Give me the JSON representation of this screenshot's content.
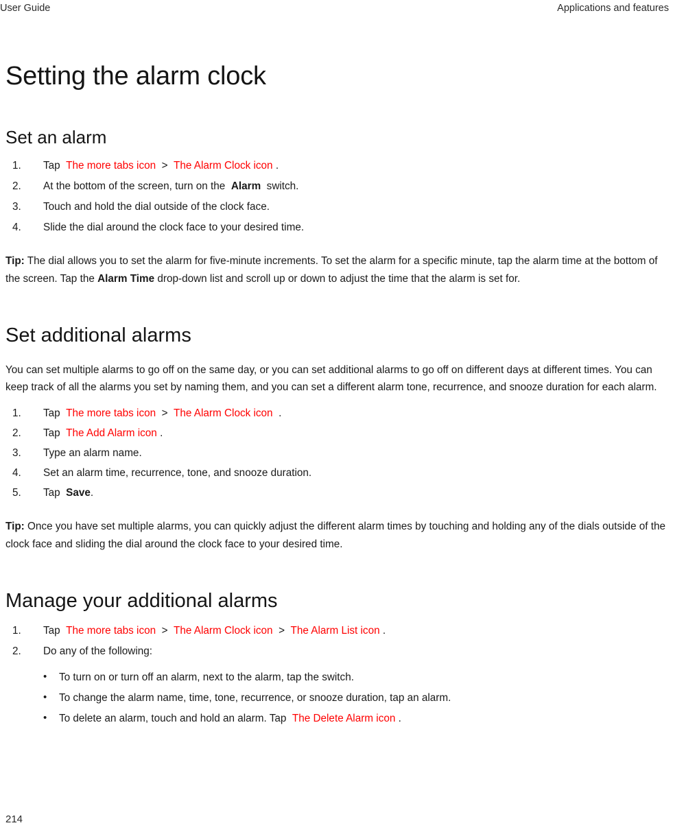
{
  "header": {
    "left": "User Guide",
    "right": "Applications and features"
  },
  "title": "Setting the alarm clock",
  "colors": {
    "icon_reference": "#ff0000",
    "text": "#1a1a1a",
    "background": "#ffffff"
  },
  "sections": {
    "set_an_alarm": {
      "heading": "Set an alarm",
      "steps": [
        {
          "pre": "Tap",
          "icon1": "The more tabs icon",
          "sep": ">",
          "icon2": "The Alarm Clock icon",
          "post": "."
        },
        {
          "pre": "At the bottom of the screen, turn on the",
          "bold": "Alarm",
          "post": "switch."
        },
        {
          "pre": "Touch and hold the dial outside of the clock face."
        },
        {
          "pre": "Slide the dial around the clock face to your desired time."
        }
      ],
      "tip": {
        "label": "Tip:",
        "part1": "The dial allows you to set the alarm for five-minute increments. To set the alarm for a specific minute, tap the alarm time at the bottom of the screen. Tap the",
        "bold": "Alarm Time",
        "part2": "drop-down list and scroll up or down to adjust the time that the alarm is set for."
      }
    },
    "set_additional_alarms": {
      "heading": "Set additional alarms",
      "intro": "You can set multiple alarms to go off on the same day, or you can set additional alarms to go off on different days at different times. You can keep track of all the alarms you set by naming them, and you can set a different alarm tone, recurrence, and snooze duration for each alarm.",
      "steps": [
        {
          "pre": "Tap",
          "icon1": "The more tabs icon",
          "sep": ">",
          "icon2": "The Alarm Clock icon",
          "post": "."
        },
        {
          "pre": "Tap",
          "icon1": "The Add Alarm icon",
          "post": "."
        },
        {
          "pre": "Type an alarm name."
        },
        {
          "pre": "Set an alarm time, recurrence, tone, and snooze duration."
        },
        {
          "pre": "Tap",
          "bold": "Save",
          "post": "."
        }
      ],
      "tip": {
        "label": "Tip:",
        "part1": "Once you have set multiple alarms, you can quickly adjust the different alarm times by touching and holding any of the dials outside of the clock face and sliding the dial around the clock face to your desired time."
      }
    },
    "manage_additional_alarms": {
      "heading": "Manage your additional alarms",
      "steps": [
        {
          "pre": "Tap",
          "icon1": "The more tabs icon",
          "sep1": ">",
          "icon2": "The Alarm Clock icon",
          "sep2": ">",
          "icon3": "The Alarm List icon",
          "post": "."
        },
        {
          "pre": "Do any of the following:"
        }
      ],
      "bullets": [
        {
          "text": "To turn on or turn off an alarm, next to the alarm, tap the switch."
        },
        {
          "text": "To change the alarm name, time, tone, recurrence, or snooze duration, tap an alarm."
        },
        {
          "pre": "To delete an alarm, touch and hold an alarm. Tap",
          "icon1": "The Delete Alarm icon",
          "post": "."
        }
      ]
    }
  },
  "footer": {
    "page_number": "214"
  }
}
